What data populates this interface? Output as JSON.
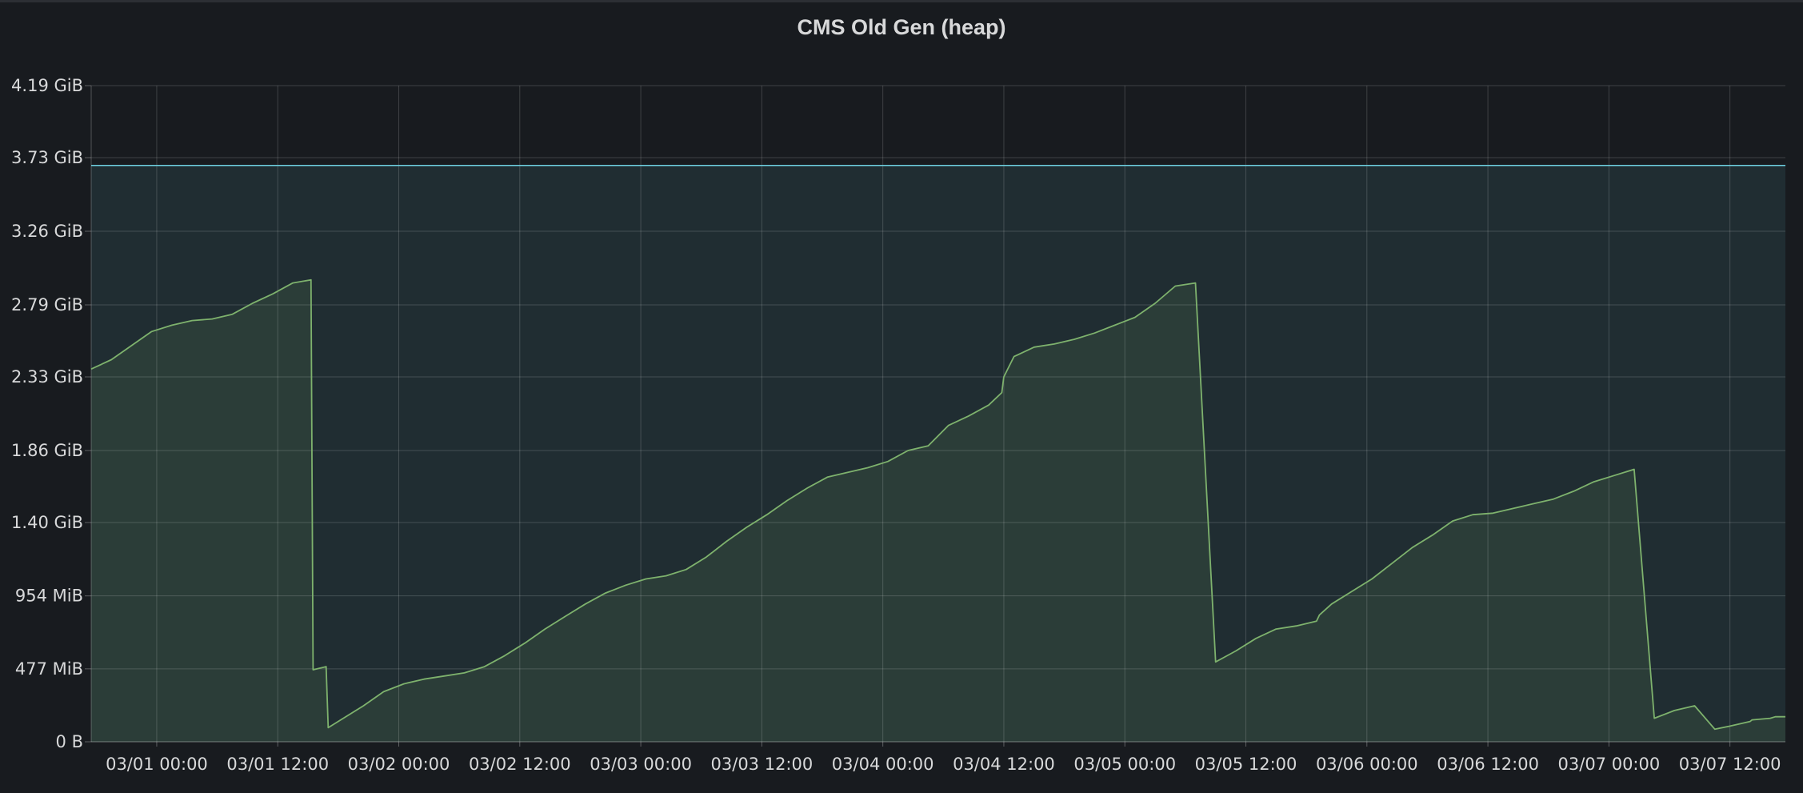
{
  "panel": {
    "title": "CMS Old Gen (heap)"
  },
  "chart_data": {
    "type": "area",
    "title": "CMS Old Gen (heap)",
    "xlabel": "",
    "ylabel": "",
    "x_unit": "hours since 03/01 00:00",
    "xlim": [
      -6.5,
      161.5
    ],
    "ylim": [
      0,
      4.19
    ],
    "y_unit": "GiB",
    "y_ticks": [
      {
        "value": 0,
        "label": "0 B"
      },
      {
        "value": 0.4658,
        "label": "477 MiB"
      },
      {
        "value": 0.9316,
        "label": "954 MiB"
      },
      {
        "value": 1.4,
        "label": "1.40 GiB"
      },
      {
        "value": 1.86,
        "label": "1.86 GiB"
      },
      {
        "value": 2.33,
        "label": "2.33 GiB"
      },
      {
        "value": 2.79,
        "label": "2.79 GiB"
      },
      {
        "value": 3.26,
        "label": "3.26 GiB"
      },
      {
        "value": 3.73,
        "label": "3.73 GiB"
      },
      {
        "value": 4.19,
        "label": "4.19 GiB"
      }
    ],
    "x_ticks": [
      {
        "value": 0,
        "label": "03/01 00:00"
      },
      {
        "value": 12,
        "label": "03/01 12:00"
      },
      {
        "value": 24,
        "label": "03/02 00:00"
      },
      {
        "value": 36,
        "label": "03/02 12:00"
      },
      {
        "value": 48,
        "label": "03/03 00:00"
      },
      {
        "value": 60,
        "label": "03/03 12:00"
      },
      {
        "value": 72,
        "label": "03/04 00:00"
      },
      {
        "value": 84,
        "label": "03/04 12:00"
      },
      {
        "value": 96,
        "label": "03/05 00:00"
      },
      {
        "value": 108,
        "label": "03/05 12:00"
      },
      {
        "value": 120,
        "label": "03/06 00:00"
      },
      {
        "value": 132,
        "label": "03/06 12:00"
      },
      {
        "value": 144,
        "label": "03/07 00:00"
      },
      {
        "value": 156,
        "label": "03/07 12:00"
      }
    ],
    "grid": true,
    "legend": "none",
    "series": [
      {
        "name": "",
        "color": "#7eb26d",
        "fill": true,
        "x": [
          -6.5,
          -4.5,
          -2.5,
          -0.5,
          1.5,
          3.5,
          5.5,
          7.5,
          9.5,
          11.5,
          13.5,
          15.3,
          15.5,
          16.8,
          17.0,
          18.5,
          20.5,
          22.5,
          24.5,
          26.5,
          28.5,
          30.5,
          32.5,
          34.5,
          36.5,
          38.5,
          40.5,
          42.5,
          44.5,
          46.5,
          48.5,
          50.5,
          52.5,
          54.5,
          56.5,
          58.5,
          60.5,
          62.5,
          64.5,
          66.5,
          68.5,
          70.5,
          72.5,
          74.5,
          76.5,
          78.5,
          80.5,
          82.5,
          83.8,
          84.0,
          85.0,
          87.0,
          89.0,
          91.0,
          93.0,
          95.0,
          97.0,
          99.0,
          101.0,
          103.0,
          105.0,
          107.0,
          109.0,
          111.0,
          113.0,
          115.0,
          115.3,
          116.5,
          118.5,
          120.5,
          122.5,
          124.5,
          126.5,
          128.5,
          130.5,
          132.5,
          134.5,
          136.5,
          138.5,
          140.5,
          142.5,
          144.5,
          146.5,
          148.5,
          150.5,
          152.5,
          154.5,
          156.0,
          158.0,
          158.2,
          160.0,
          160.5,
          161.5
        ],
        "values": [
          2.38,
          2.44,
          2.53,
          2.62,
          2.66,
          2.69,
          2.7,
          2.73,
          2.8,
          2.86,
          2.93,
          2.95,
          0.46,
          0.48,
          0.09,
          0.15,
          0.23,
          0.32,
          0.37,
          0.4,
          0.42,
          0.44,
          0.48,
          0.55,
          0.63,
          0.72,
          0.8,
          0.88,
          0.95,
          1.0,
          1.04,
          1.06,
          1.1,
          1.18,
          1.28,
          1.37,
          1.45,
          1.54,
          1.62,
          1.69,
          1.72,
          1.75,
          1.79,
          1.86,
          1.89,
          2.02,
          2.08,
          2.15,
          2.23,
          2.33,
          2.46,
          2.52,
          2.54,
          2.57,
          2.61,
          2.66,
          2.71,
          2.8,
          2.91,
          2.93,
          0.51,
          0.58,
          0.66,
          0.72,
          0.74,
          0.77,
          0.81,
          0.88,
          0.96,
          1.04,
          1.14,
          1.24,
          1.32,
          1.41,
          1.45,
          1.46,
          1.49,
          1.52,
          1.55,
          1.6,
          1.66,
          1.7,
          1.74,
          0.15,
          0.2,
          0.23,
          0.08,
          0.1,
          0.13,
          0.14,
          0.15,
          0.16,
          0.16
        ]
      },
      {
        "name": "",
        "color": "#6ed0e0",
        "fill": true,
        "x": [
          -6.5,
          161.5
        ],
        "values": [
          3.68,
          3.68
        ]
      }
    ]
  }
}
